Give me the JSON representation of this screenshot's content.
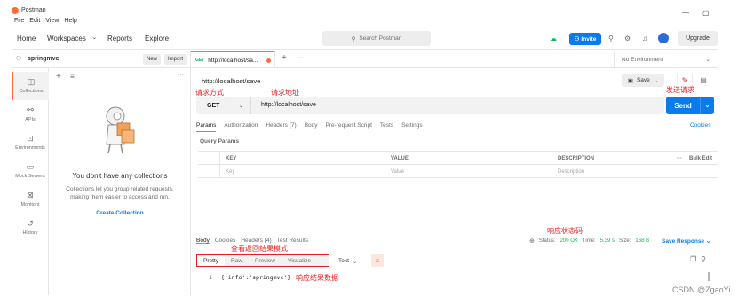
{
  "app": {
    "name": "Postman",
    "menu": [
      "File",
      "Edit",
      "View",
      "Help"
    ]
  },
  "header": {
    "nav": [
      "Home",
      "Workspaces",
      "Reports",
      "Explore"
    ],
    "search_placeholder": "Search Postman",
    "invite_label": "Invite",
    "upgrade_label": "Upgrade"
  },
  "workspace": {
    "name": "springmvc",
    "new_label": "New",
    "import_label": "Import"
  },
  "sidebar": {
    "items": [
      {
        "label": "Collections",
        "icon": "collections-icon"
      },
      {
        "label": "APIs",
        "icon": "apis-icon"
      },
      {
        "label": "Environments",
        "icon": "environments-icon"
      },
      {
        "label": "Mock Servers",
        "icon": "mock-servers-icon"
      },
      {
        "label": "Monitors",
        "icon": "monitors-icon"
      },
      {
        "label": "History",
        "icon": "history-icon"
      }
    ],
    "empty_title": "You don't have any collections",
    "empty_desc": "Collections let you group related requests, making them easier to access and run.",
    "create_label": "Create Collection"
  },
  "tab": {
    "method": "GET",
    "title": "http://localhost/sa...",
    "environment": "No Environment"
  },
  "request": {
    "title": "http://localhost/save",
    "save_label": "Save",
    "method": "GET",
    "url": "http://localhost/save",
    "send_label": "Send",
    "tabs": [
      "Params",
      "Authorization",
      "Headers (7)",
      "Body",
      "Pre-request Script",
      "Tests",
      "Settings"
    ],
    "cookies_label": "Cookies",
    "query_params_label": "Query Params",
    "columns": [
      "KEY",
      "VALUE",
      "DESCRIPTION"
    ],
    "bulk_edit_label": "Bulk Edit",
    "placeholders": [
      "Key",
      "Value",
      "Description"
    ]
  },
  "annotations": {
    "method": "请求方式",
    "url": "请求地址",
    "send": "发送请求",
    "status": "响应状态码",
    "format": "查看返回结果模式",
    "result": "响应结果数据"
  },
  "response": {
    "tabs": [
      "Body",
      "Cookies",
      "Headers (4)",
      "Test Results"
    ],
    "status_label": "Status:",
    "status_value": "200 OK",
    "time_label": "Time:",
    "time_value": "5.39 s",
    "size_label": "Size:",
    "size_value": "168 B",
    "save_label": "Save Response",
    "formats": [
      "Pretty",
      "Raw",
      "Preview",
      "Visualize"
    ],
    "language": "Text",
    "line_number": "1",
    "body": "{'info':'springmvc'}"
  },
  "watermark": "CSDN @ZgaoYi"
}
